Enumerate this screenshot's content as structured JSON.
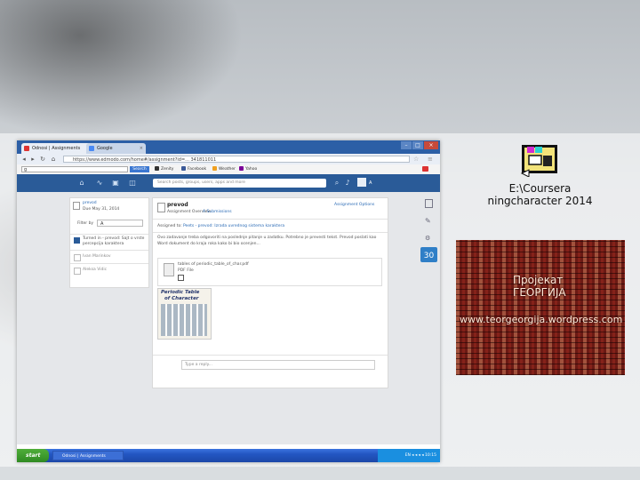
{
  "browser": {
    "tabs": [
      {
        "label": "Odnosi | Assignments"
      },
      {
        "label": "Google"
      }
    ],
    "window_buttons": [
      "–",
      "□",
      "×"
    ],
    "address": "https://www.edmodo.com/home#/assignment?id=... 341811011 ",
    "google_bar": {
      "search_button": "Search",
      "bookmarks": [
        "Zenity",
        "Facebook",
        "Weather",
        "Yahoo"
      ]
    }
  },
  "app": {
    "search_placeholder": "Search posts, groups, users, apps and more",
    "user_initial": "A"
  },
  "sidebar_card": {
    "title": "prevod",
    "due": "Due May 31, 2014",
    "filter_label": "Filter by",
    "filter_value": "A",
    "items": [
      {
        "text": "Turned in - prevod: Sajt o vrste percepcija karaktera"
      },
      {
        "text": "Ivan Marinkov"
      },
      {
        "text": "Aleksa Vidic"
      }
    ]
  },
  "assignment": {
    "title": "prevod",
    "tab_overview": "Assignment Overview",
    "tab_submissions": "A Submissions",
    "options": "Assignment Options",
    "assigned_to_label": "Assigned to:",
    "assigned_to_value": "Peets - prevod: Izrada uvrednog sistema karaktera",
    "description": "Ovo zadavanje treba odgovoriti na poslednje pitanje u zadatku. Potrebno je prevesti tekst. Prevod poslati kao Word dokument do kraja roka kako bi bio ocenjen...",
    "attachment_name": "tables of periodic_table_of_char.pdf",
    "attachment_type": "PDF File",
    "image_title_line1": "Periodic Table",
    "image_title_line2": "of Character",
    "reply_placeholder": "Type a reply..."
  },
  "right_rail": {
    "calendar_day": "30"
  },
  "taskbar": {
    "start": "start",
    "window_item": "Odnosi | Assignments",
    "tray": "EN  ◂ ◂ ◂ ◂ 10:15"
  },
  "desktop": {
    "shortcut_label_line1": "E:\\Coursera",
    "shortcut_label_line2": "ningcharacter 2014",
    "brick_line1": "Пројекат",
    "brick_line2": "ГЕОРГИЈА",
    "brick_line3": "www.teorgeorgija.wordpress.com"
  },
  "colors": {
    "app_header": "#2a5b98",
    "tab_bar": "#2c5fa6",
    "link": "#2a6ab5",
    "brick": "#6b1a14"
  }
}
